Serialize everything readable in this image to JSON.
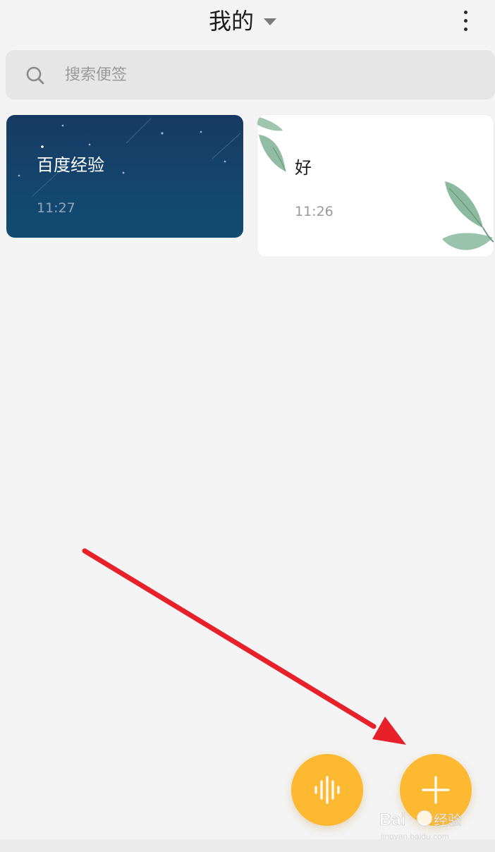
{
  "header": {
    "title": "我的",
    "more_icon": "more-vertical-icon",
    "dropdown_icon": "caret-down-icon"
  },
  "search": {
    "placeholder": "搜索便签",
    "icon": "search-icon"
  },
  "notes": [
    {
      "title": "百度经验",
      "time": "11:27",
      "theme": "night-sky",
      "theme_color": "#173a64"
    },
    {
      "title": "好",
      "time": "11:26",
      "theme": "leaves",
      "theme_color": "#ffffff"
    }
  ],
  "fabs": {
    "voice_icon": "waveform-icon",
    "add_icon": "plus-icon",
    "color": "#fdb931"
  },
  "annotation": {
    "arrow_color": "#e8202a"
  },
  "watermark": {
    "logo": "Baidu经验",
    "url": "jingyan.baidu.com"
  }
}
